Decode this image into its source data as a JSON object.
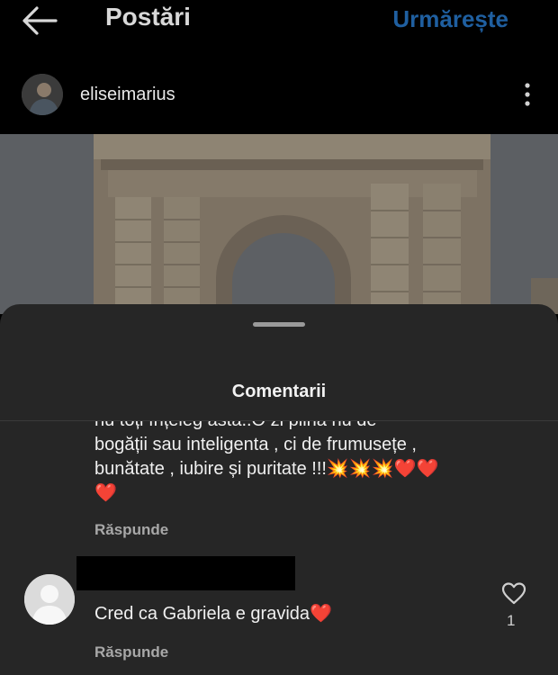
{
  "header": {
    "title": "Postări",
    "follow_label": "Urmărește"
  },
  "post": {
    "username": "eliseimarius"
  },
  "comments_sheet": {
    "title": "Comentarii",
    "comments": [
      {
        "lines": [
          "nu toți înțeleg asta..O zi plină nu de",
          "bogății sau inteligenta , ci de frumusețe ,",
          "bunătate , iubire și puritate !!!💥💥💥❤️❤️",
          "❤️"
        ],
        "reply_label": "Răspunde"
      },
      {
        "text": "Cred ca Gabriela e gravida❤️",
        "reply_label": "Răspunde",
        "likes": "1"
      }
    ]
  },
  "icons": {
    "back": "arrow-left-icon",
    "more": "more-vertical-icon",
    "like": "heart-outline-icon",
    "avatar_placeholder": "user-silhouette-icon"
  },
  "colors": {
    "follow": "#1f5fa0",
    "sheet_background": "#262626",
    "screen_background": "#000000"
  }
}
